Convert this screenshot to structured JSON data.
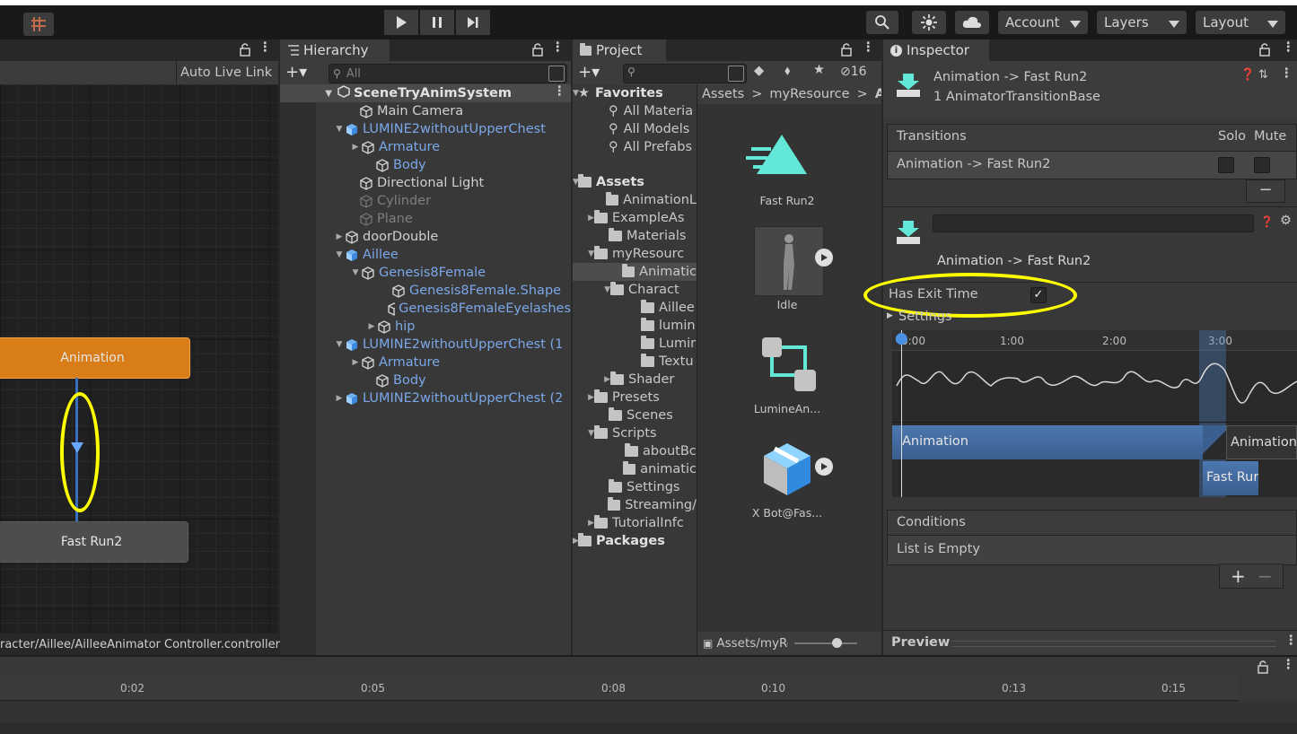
{
  "toolbar": {
    "account_label": "Account",
    "layers_label": "Layers",
    "layout_label": "Layout"
  },
  "animator": {
    "auto_live_link": "Auto Live Link",
    "state_top": "Animation",
    "state_bottom": "Fast Run2",
    "footer_path": "racter/Aillee/AilleeAnimator Controller.controller"
  },
  "hierarchy": {
    "tab_label": "Hierarchy",
    "search_placeholder": "All",
    "scene_name": "SceneTryAnimSystem",
    "items": [
      {
        "label": "Main Camera",
        "style": "normal"
      },
      {
        "label": "LUMINE2withoutUpperChest",
        "style": "blue"
      },
      {
        "label": "Armature",
        "style": "blue"
      },
      {
        "label": "Body",
        "style": "blue"
      },
      {
        "label": "Directional Light",
        "style": "normal"
      },
      {
        "label": "Cylinder",
        "style": "dim"
      },
      {
        "label": "Plane",
        "style": "dim"
      },
      {
        "label": "doorDouble",
        "style": "normal"
      },
      {
        "label": "Aillee",
        "style": "blue"
      },
      {
        "label": "Genesis8Female",
        "style": "blue"
      },
      {
        "label": "Genesis8Female.Shape",
        "style": "blue"
      },
      {
        "label": "Genesis8FemaleEyelashes",
        "style": "blue"
      },
      {
        "label": "hip",
        "style": "blue"
      },
      {
        "label": "LUMINE2withoutUpperChest (1",
        "style": "blue"
      },
      {
        "label": "Armature",
        "style": "blue"
      },
      {
        "label": "Body",
        "style": "blue"
      },
      {
        "label": "LUMINE2withoutUpperChest (2",
        "style": "blue"
      }
    ]
  },
  "project": {
    "tab_label": "Project",
    "hidden_count": "16",
    "breadcrumb": [
      "Assets",
      "myResource",
      "Ar"
    ],
    "tree": [
      {
        "label": "Favorites"
      },
      {
        "label": "All Materia"
      },
      {
        "label": "All Models"
      },
      {
        "label": "All Prefabs"
      },
      {
        "label": "Assets"
      },
      {
        "label": "AnimationL"
      },
      {
        "label": "ExampleAs"
      },
      {
        "label": "Materials"
      },
      {
        "label": "myResourc"
      },
      {
        "label": "Animatic"
      },
      {
        "label": "Charact"
      },
      {
        "label": "Aillee"
      },
      {
        "label": "lumin"
      },
      {
        "label": "Lumir"
      },
      {
        "label": "Textu"
      },
      {
        "label": "Shader"
      },
      {
        "label": "Presets"
      },
      {
        "label": "Scenes"
      },
      {
        "label": "Scripts"
      },
      {
        "label": "aboutBc"
      },
      {
        "label": "animatic"
      },
      {
        "label": "Settings"
      },
      {
        "label": "Streaming/"
      },
      {
        "label": "TutorialInfc"
      },
      {
        "label": "Packages"
      }
    ],
    "assets": [
      {
        "label": "Fast Run2"
      },
      {
        "label": "Idle"
      },
      {
        "label": "LumineAn..."
      },
      {
        "label": "X Bot@Fas..."
      }
    ],
    "footer_path": "Assets/myRe"
  },
  "inspector": {
    "tab_label": "Inspector",
    "title": "Animation -> Fast Run2",
    "subtitle": "1 AnimatorTransitionBase",
    "transitions_header": "Transitions",
    "solo_label": "Solo",
    "mute_label": "Mute",
    "transition_row": "Animation -> Fast Run2",
    "transition_name_label": "Animation -> Fast Run2",
    "has_exit_time_label": "Has Exit Time",
    "settings_label": "Settings",
    "timeline_ticks": [
      "0:00",
      "1:00",
      "2:00",
      "3:00"
    ],
    "timeline_clip_a": "Animation",
    "timeline_clip_a2": "Animation",
    "timeline_clip_b": "Fast Rur",
    "conditions_header": "Conditions",
    "conditions_body": "List is Empty",
    "preview_label": "Preview"
  },
  "timeline": {
    "ticks": [
      "0:02",
      "0:05",
      "0:08",
      "0:10",
      "0:13",
      "0:15"
    ]
  },
  "colors": {
    "state_orange": "#d97f19",
    "state_gray": "#4d4d4d",
    "highlight_yellow": "#ffff00",
    "accent_teal": "#63e8d7"
  }
}
